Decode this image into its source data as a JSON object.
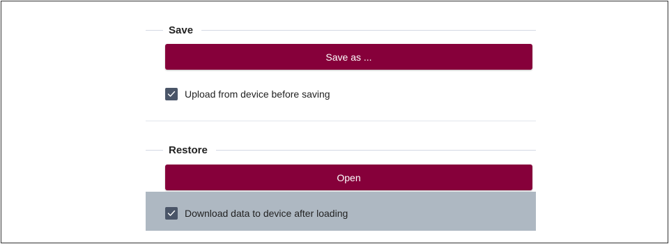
{
  "save_section": {
    "title": "Save",
    "button_label": "Save as ...",
    "checkbox": {
      "label": "Upload from device before saving",
      "checked": true
    }
  },
  "restore_section": {
    "title": "Restore",
    "button_label": "Open",
    "checkbox": {
      "label": "Download data to device after loading",
      "checked": true
    }
  },
  "icons": {
    "checkmark": "check-icon"
  },
  "colors": {
    "primary_button": "#86003a",
    "checkbox_fill": "#4a5568",
    "highlight_band": "#aeb8c2",
    "separator_line": "#d4d8e4"
  }
}
